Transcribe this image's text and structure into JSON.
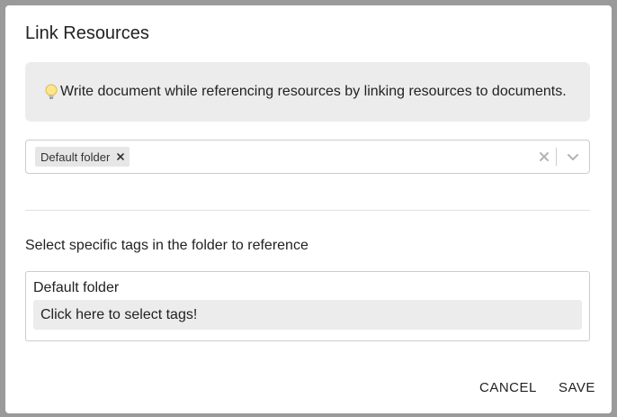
{
  "dialog": {
    "title": "Link Resources",
    "info_text": "Write document while referencing resources by linking resources to documents.",
    "info_icon": "lightbulb-icon"
  },
  "folder_select": {
    "selected": [
      {
        "label": "Default folder",
        "remove_icon": "close-icon"
      }
    ],
    "clear_icon": "close-icon",
    "dropdown_icon": "chevron-down-icon"
  },
  "tags_section": {
    "heading": "Select specific tags in the folder to reference",
    "folders": [
      {
        "name": "Default folder",
        "tag_placeholder": "Click here to select tags!"
      }
    ]
  },
  "actions": {
    "cancel_label": "CANCEL",
    "save_label": "SAVE"
  },
  "colors": {
    "info_bg": "#ececec",
    "chip_bg": "#e6e6e6",
    "border": "#cccccc",
    "backdrop": "#9a9a9a"
  }
}
